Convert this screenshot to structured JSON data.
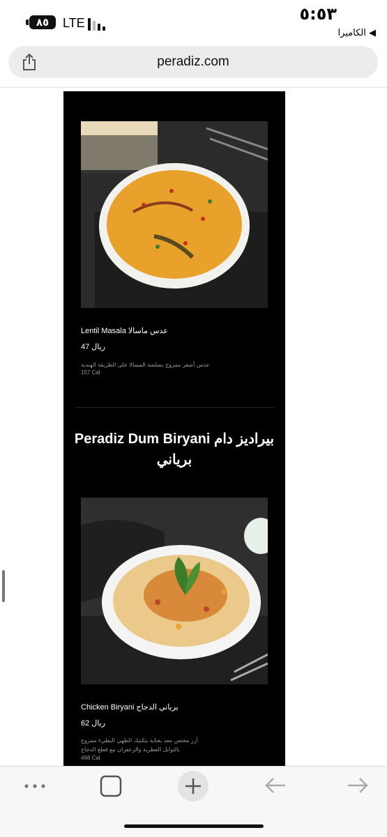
{
  "status_bar": {
    "battery": "٨٥",
    "network": "LTE",
    "time": "٥:٥٣",
    "back_app": "◀ الكاميرا"
  },
  "browser": {
    "url": "peradiz.com"
  },
  "menu": {
    "dishes": [
      {
        "name": "Lentil Masala عدس ماسالا",
        "price": "ريال 47",
        "description": "عدس أصفر ممزوج بصلصة المسالا على الطريقة الهندية",
        "calories": "157 Cal"
      },
      {
        "name": "Chicken Biryani برياني الدجاج",
        "price": "ريال 62",
        "description": "أرز مختص معد بعناية بتكنيك الطهي البطيء ممزوج بالتوابل العطرية والزعفران مع قطع الدجاج",
        "calories": "468 Cal"
      }
    ],
    "section_title": "Peradiz Dum Biryani بيراديز دام برياني"
  },
  "colors": {
    "menu_background": "#000000",
    "address_bar": "#ececee",
    "toolbar_icon": "#9a9a9a"
  },
  "icons": {
    "share": "share-icon",
    "more": "more-icon",
    "tabs": "tabs-icon",
    "new_tab": "plus-icon",
    "back": "back-arrow-icon",
    "forward": "forward-arrow-icon"
  }
}
